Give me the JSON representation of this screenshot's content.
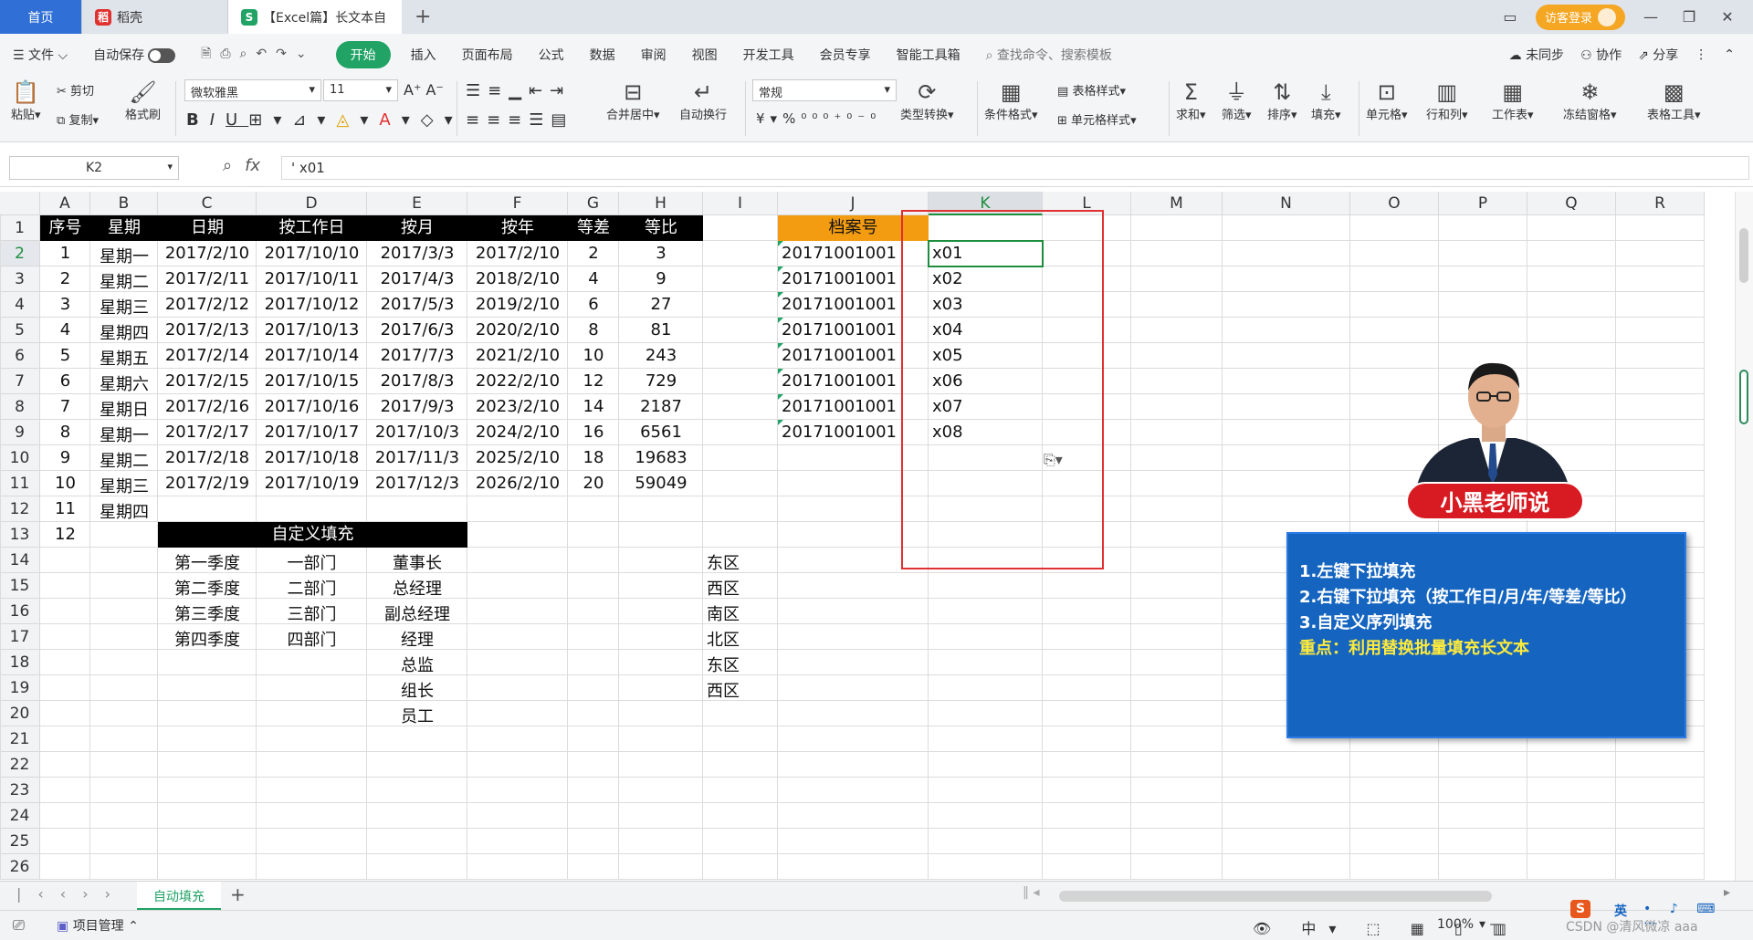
{
  "tabs": {
    "home": "首页",
    "docer": "稻壳",
    "active": "【Excel篇】长文本自"
  },
  "titlebar": {
    "login": "访客登录"
  },
  "menu": {
    "file": "文件",
    "autosave": "自动保存",
    "start": "开始",
    "items": [
      "插入",
      "页面布局",
      "公式",
      "数据",
      "审阅",
      "视图",
      "开发工具",
      "会员专享",
      "智能工具箱"
    ],
    "search": "查找命令、搜索模板",
    "sync": "未同步",
    "collab": "协作",
    "share": "分享"
  },
  "ribbon": {
    "paste": "粘贴",
    "cut": "剪切",
    "copy": "复制",
    "format_painter": "格式刷",
    "font": "微软雅黑",
    "size": "11",
    "merge": "合并居中",
    "wrap": "自动换行",
    "numfmt": "常规",
    "type_convert": "类型转换",
    "cond_format": "条件格式",
    "table_style": "表格样式",
    "cell_style": "单元格样式",
    "sum": "求和",
    "filter": "筛选",
    "sort": "排序",
    "fill": "填充",
    "cells": "单元格",
    "rowcol": "行和列",
    "sheet": "工作表",
    "freeze": "冻结窗格",
    "tools": "表格工具"
  },
  "formula": {
    "namebox": "K2",
    "content": "' x01"
  },
  "columns": [
    "A",
    "B",
    "C",
    "D",
    "E",
    "F",
    "G",
    "H",
    "I",
    "J",
    "K",
    "L",
    "M",
    "N",
    "O",
    "P",
    "Q",
    "R"
  ],
  "rows": [
    "1",
    "2",
    "3",
    "4",
    "5",
    "6",
    "7",
    "8",
    "9",
    "10",
    "11",
    "12",
    "13",
    "14",
    "15",
    "16",
    "17",
    "18",
    "19",
    "20",
    "21",
    "22",
    "23",
    "24",
    "25",
    "26"
  ],
  "headers": [
    "序号",
    "星期",
    "日期",
    "按工作日",
    "按月",
    "按年",
    "等差",
    "等比"
  ],
  "table": [
    [
      "1",
      "星期一",
      "2017/2/10",
      "2017/10/10",
      "2017/3/3",
      "2017/2/10",
      "2",
      "3"
    ],
    [
      "2",
      "星期二",
      "2017/2/11",
      "2017/10/11",
      "2017/4/3",
      "2018/2/10",
      "4",
      "9"
    ],
    [
      "3",
      "星期三",
      "2017/2/12",
      "2017/10/12",
      "2017/5/3",
      "2019/2/10",
      "6",
      "27"
    ],
    [
      "4",
      "星期四",
      "2017/2/13",
      "2017/10/13",
      "2017/6/3",
      "2020/2/10",
      "8",
      "81"
    ],
    [
      "5",
      "星期五",
      "2017/2/14",
      "2017/10/14",
      "2017/7/3",
      "2021/2/10",
      "10",
      "243"
    ],
    [
      "6",
      "星期六",
      "2017/2/15",
      "2017/10/15",
      "2017/8/3",
      "2022/2/10",
      "12",
      "729"
    ],
    [
      "7",
      "星期日",
      "2017/2/16",
      "2017/10/16",
      "2017/9/3",
      "2023/2/10",
      "14",
      "2187"
    ],
    [
      "8",
      "星期一",
      "2017/2/17",
      "2017/10/17",
      "2017/10/3",
      "2024/2/10",
      "16",
      "6561"
    ],
    [
      "9",
      "星期二",
      "2017/2/18",
      "2017/10/18",
      "2017/11/3",
      "2025/2/10",
      "18",
      "19683"
    ],
    [
      "10",
      "星期三",
      "2017/2/19",
      "2017/10/19",
      "2017/12/3",
      "2026/2/10",
      "20",
      "59049"
    ],
    [
      "11",
      "星期四",
      "",
      "",
      "",
      "",
      "",
      ""
    ],
    [
      "12",
      "",
      "",
      "",
      "",
      "",
      "",
      ""
    ]
  ],
  "custom_fill": {
    "title": "自定义填充",
    "quarters": [
      "第一季度",
      "第二季度",
      "第三季度",
      "第四季度"
    ],
    "depts": [
      "一部门",
      "二部门",
      "三部门",
      "四部门"
    ],
    "titles": [
      "董事长",
      "总经理",
      "副总经理",
      "经理",
      "总监",
      "组长",
      "员工"
    ],
    "regions": [
      "东区",
      "西区",
      "南区",
      "北区",
      "东区",
      "西区"
    ]
  },
  "archive": {
    "header": "档案号",
    "numbers": [
      "20171001001",
      "20171001001",
      "20171001001",
      "20171001001",
      "20171001001",
      "20171001001",
      "20171001001",
      "20171001001"
    ],
    "codes": [
      "x01",
      "x02",
      "x03",
      "x04",
      "x05",
      "x06",
      "x07",
      "x08"
    ]
  },
  "promo": {
    "teacher": "小黑老师说",
    "line1": "1.左键下拉填充",
    "line2": "2.右键下拉填充（按工作日/月/年/等差/等比）",
    "line3": "3.自定义序列填充",
    "line4": "重点：利用替换批量填充长文本"
  },
  "sheet": {
    "tab": "自动填充"
  },
  "status": {
    "project": "项目管理",
    "zoom": "100%",
    "ime": "英",
    "watermark": "CSDN @清风微凉 aaa"
  },
  "colors": {
    "accent_green": "#21a366",
    "header_black": "#000000",
    "archive_orange": "#f39c12",
    "red_box": "#e03030",
    "promo_blue": "#1565c0"
  }
}
